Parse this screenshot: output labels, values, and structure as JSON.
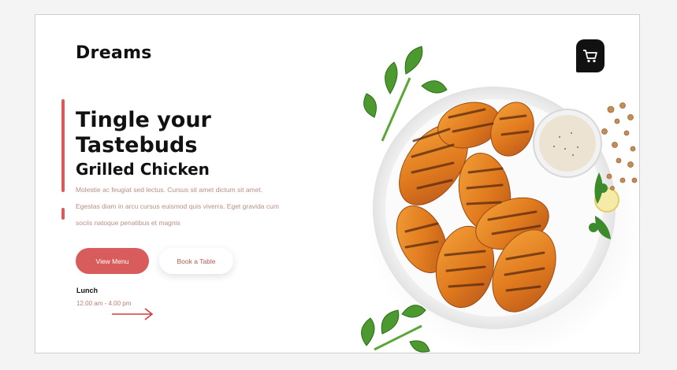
{
  "brand": {
    "name": "Dreams"
  },
  "hero": {
    "title_line1": "Tingle your",
    "title_line2": "Tastebuds",
    "subtitle": "Grilled Chicken",
    "description": "Molestie ac feugiat sed lectus. Cursus sit amet dictum sit amet. Egestas diam in arcu cursus euismod quis viverra. Eget gravida cum sociis natoque penatibus et magnis"
  },
  "buttons": {
    "primary": "View Menu",
    "secondary": "Book a Table"
  },
  "hours": {
    "label": "Lunch",
    "time": "12.00 am - 4.00 pm"
  },
  "icons": {
    "cart": "shopping-cart-icon",
    "arrow": "arrow-right-icon"
  },
  "colors": {
    "accent": "#d95c5c",
    "text": "#111111",
    "muted": "#b98f86"
  }
}
